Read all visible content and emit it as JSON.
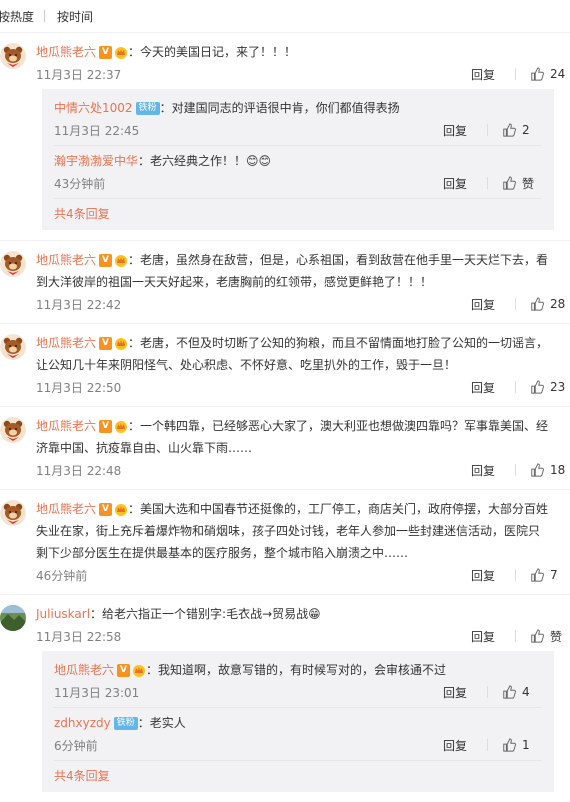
{
  "tabs": [
    "按热度",
    "按时间"
  ],
  "comments": [
    {
      "name": "地瓜熊老六",
      "text": "：今天的美国日记，来了！！！",
      "time": "11月3日 22:37",
      "reply": "回复",
      "likes": "24",
      "subs": [
        {
          "name": "中情六处1002",
          "badge": "铁粉",
          "text": "：对建国同志的评语很中肯，你们都值得表扬",
          "time": "11月3日 22:45",
          "reply": "回复",
          "likes": "2"
        },
        {
          "name": "瀚宇渤渤爱中华",
          "text": "：老六经典之作！！😊😊",
          "time": "43分钟前",
          "reply": "回复",
          "likes": "赞"
        }
      ],
      "more": "共4条回复"
    },
    {
      "name": "地瓜熊老六",
      "text": "：老唐，虽然身在敌营，但是，心系祖国，看到敌营在他手里一天天烂下去，看到大洋彼岸的祖国一天天好起来，老唐胸前的红领带，感觉更鲜艳了！！！",
      "time": "11月3日 22:42",
      "reply": "回复",
      "likes": "28"
    },
    {
      "name": "地瓜熊老六",
      "text": "：老唐，不但及时切断了公知的狗粮，而且不留情面地打脸了公知的一切谣言，让公知几十年来阴阳怪气、处心积虑、不怀好意、吃里扒外的工作，毁于一旦！",
      "time": "11月3日 22:50",
      "reply": "回复",
      "likes": "23"
    },
    {
      "name": "地瓜熊老六",
      "text": "：一个韩四靠，已经够恶心大家了，澳大利亚也想做澳四靠吗？军事靠美国、经济靠中国、抗疫靠自由、山火靠下雨……",
      "time": "11月3日 22:48",
      "reply": "回复",
      "likes": "18"
    },
    {
      "name": "地瓜熊老六",
      "text": "：美国大选和中国春节还挺像的，工厂停工，商店关门，政府停摆，大部分百姓失业在家，街上充斥着爆炸物和硝烟味，孩子四处讨钱，老年人参加一些封建迷信活动，医院只剩下少部分医生在提供最基本的医疗服务，整个城市陷入崩溃之中……",
      "time": "46分钟前",
      "reply": "回复",
      "likes": "7"
    },
    {
      "name": "Juliuskarl",
      "text": "：给老六指正一个错别字:毛衣战→贸易战😁",
      "time": "11月3日 22:58",
      "reply": "回复",
      "likes": "赞",
      "subs": [
        {
          "name": "地瓜熊老六",
          "text": "：我知道啊，故意写错的，有时候写对的，会审核通不过",
          "time": "11月3日 23:01",
          "reply": "回复",
          "likes": "4"
        },
        {
          "name": "zdhxyzdy",
          "badge": "铁粉",
          "text": "：老实人",
          "time": "6分钟前",
          "reply": "回复",
          "likes": "1"
        }
      ],
      "more": "共4条回复"
    }
  ]
}
